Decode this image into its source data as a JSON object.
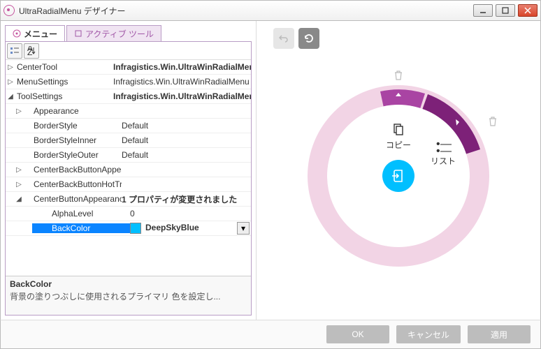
{
  "window": {
    "title": "UltraRadialMenu デザイナー"
  },
  "tabs": {
    "menu": "メニュー",
    "active_tool": "アクティブ ツール"
  },
  "props": {
    "rows": [
      {
        "arrow": "▷",
        "indent": 0,
        "key": "CenterTool",
        "val": "Infragistics.Win.UltraWinRadialMenu",
        "bold": true
      },
      {
        "arrow": "▷",
        "indent": 0,
        "key": "MenuSettings",
        "val": "Infragistics.Win.UltraWinRadialMenu",
        "bold": false
      },
      {
        "arrow": "◢",
        "indent": 0,
        "key": "ToolSettings",
        "val": "Infragistics.Win.UltraWinRadialMenu",
        "bold": true
      },
      {
        "arrow": "▷",
        "indent": 1,
        "key": "Appearance",
        "val": "",
        "bold": false
      },
      {
        "arrow": "",
        "indent": 1,
        "key": "BorderStyle",
        "val": "Default",
        "bold": false
      },
      {
        "arrow": "",
        "indent": 1,
        "key": "BorderStyleInner",
        "val": "Default",
        "bold": false
      },
      {
        "arrow": "",
        "indent": 1,
        "key": "BorderStyleOuter",
        "val": "Default",
        "bold": false
      },
      {
        "arrow": "▷",
        "indent": 1,
        "key": "CenterBackButtonAppearance",
        "val": "",
        "bold": false
      },
      {
        "arrow": "▷",
        "indent": 1,
        "key": "CenterBackButtonHotTrackAppearance",
        "val": "",
        "bold": false
      },
      {
        "arrow": "◢",
        "indent": 1,
        "key": "CenterButtonAppearance",
        "val": "1 プロパティが変更されました",
        "bold": true
      },
      {
        "arrow": "",
        "indent": 2,
        "key": "AlphaLevel",
        "val": "0",
        "bold": false
      },
      {
        "arrow": "",
        "indent": 2,
        "key": "BackColor",
        "val": "DeepSkyBlue",
        "bold": true,
        "selected": true,
        "swatch": "#00BFFF",
        "dropdown": true
      }
    ],
    "desc_title": "BackColor",
    "desc_body": "背景の塗りつぶしに使用されるプライマリ 色を設定し..."
  },
  "radial": {
    "wedge1_label": "コピー",
    "wedge2_label": "リスト",
    "center_color": "#00BFFF",
    "ring_color": "#f2d4e5",
    "active_wedge_color": "#932a8e",
    "dark_wedge_color": "#7a1f74"
  },
  "footer": {
    "ok": "OK",
    "cancel": "キャンセル",
    "apply": "適用"
  }
}
